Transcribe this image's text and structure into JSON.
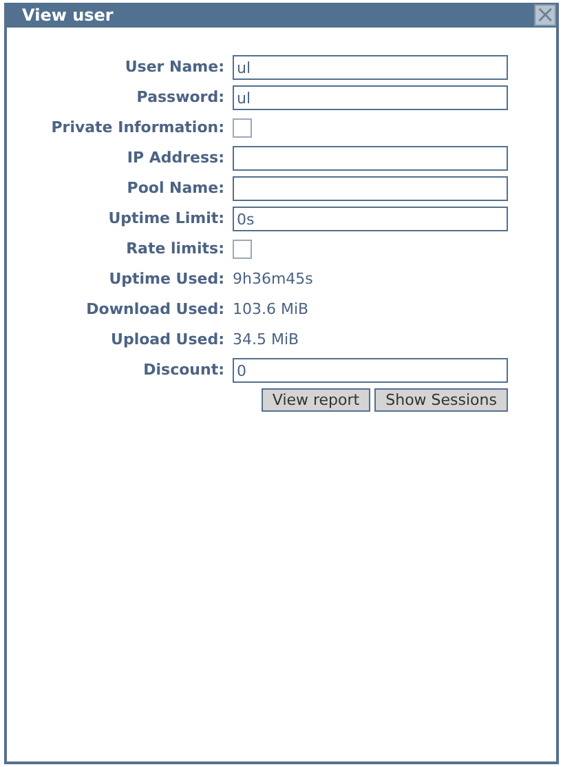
{
  "window": {
    "title": "View user",
    "close": "×"
  },
  "fields": [
    {
      "kind": "text",
      "label": "User Name:",
      "value": "ul"
    },
    {
      "kind": "text",
      "label": "Password:",
      "value": "ul"
    },
    {
      "kind": "checkbox",
      "label": "Private Information:",
      "checked": false
    },
    {
      "kind": "text",
      "label": "IP Address:"
    },
    {
      "kind": "text",
      "label": "Pool Name:"
    },
    {
      "kind": "text",
      "label": "Uptime Limit:",
      "value": "0s"
    },
    {
      "kind": "checkbox",
      "label": "Rate limits:",
      "checked": false
    },
    {
      "kind": "value",
      "label": "Uptime Used:",
      "value": "9h36m45s"
    },
    {
      "kind": "value",
      "label": "Download Used:",
      "value": "103.6 MiB"
    },
    {
      "kind": "value",
      "label": "Upload Used:",
      "value": "34.5 MiB"
    },
    {
      "kind": "text",
      "label": "Discount:",
      "value": "0"
    }
  ],
  "buttons": [
    "View report",
    "Show Sessions"
  ]
}
